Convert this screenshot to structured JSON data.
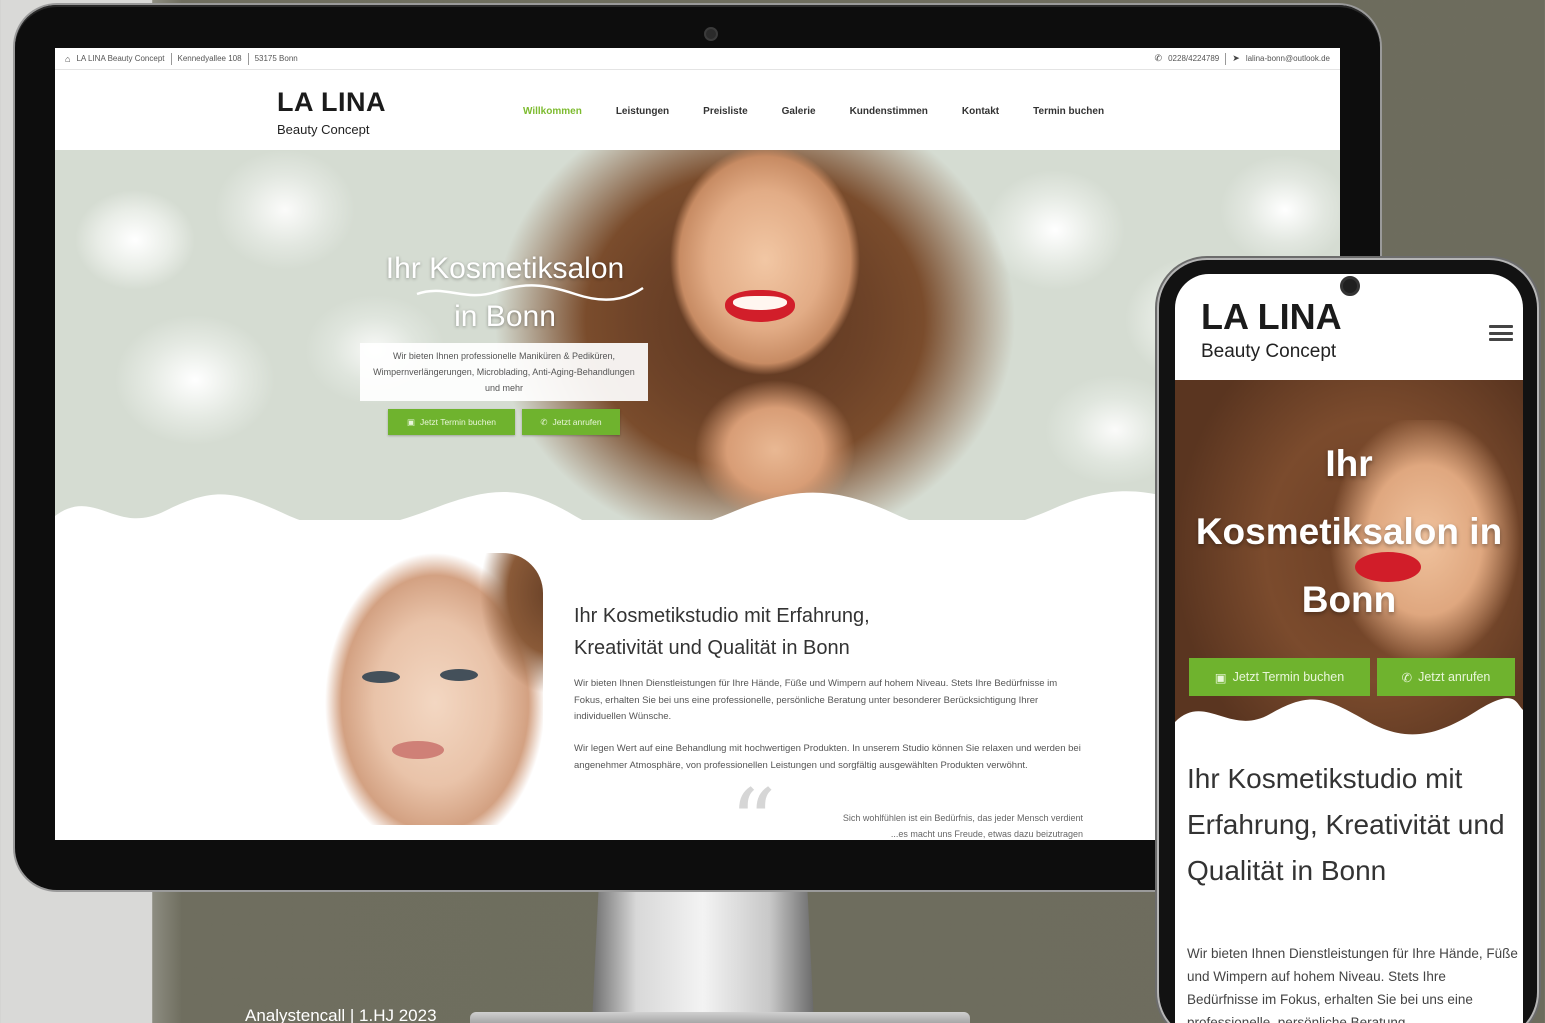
{
  "colors": {
    "accent_green": "#7dbb2f",
    "button_green": "#6fb32e",
    "backdrop": "#6f6e5f"
  },
  "desktop": {
    "topbar": {
      "left": [
        "LA LINA Beauty Concept",
        "Kennedyallee 108",
        "53175 Bonn"
      ],
      "phone": "0228/4224789",
      "email": "lalina-bonn@outlook.de"
    },
    "logo": {
      "main": "LA LINA",
      "sub": "Beauty Concept"
    },
    "nav": [
      "Willkommen",
      "Leistungen",
      "Preisliste",
      "Galerie",
      "Kundenstimmen",
      "Kontakt",
      "Termin buchen"
    ],
    "hero": {
      "title_line1": "Ihr Kosmetiksalon",
      "title_line2": "in Bonn",
      "description": "Wir bieten Ihnen professionelle Maniküren & Pediküren, Wimpernverlängerungen, Microblading, Anti-Aging-Behandlungen und mehr",
      "btn_book": "Jetzt Termin buchen",
      "btn_call": "Jetzt anrufen"
    },
    "side_icons": [
      "phone-icon",
      "mail-icon",
      "whatsapp-icon"
    ],
    "content": {
      "title_line1": "Ihr Kosmetikstudio mit Erfahrung,",
      "title_line2": "Kreativität und Qualität in Bonn",
      "p1": "Wir bieten Ihnen Dienstleistungen für Ihre Hände, Füße und Wimpern auf hohem Niveau. Stets Ihre Bedürfnisse im Fokus, erhalten Sie bei uns eine professionelle, persönliche Beratung unter besonderer Berücksichtigung Ihrer individuellen Wünsche.",
      "p2": "Wir legen Wert auf eine Behandlung mit hochwertigen Produkten. In unserem Studio können Sie relaxen und werden bei angenehmer Atmosphäre, von professionellen Leistungen und sorgfältig ausgewählten Produkten verwöhnt.",
      "quote_line1": "Sich wohlfühlen ist ein Bedürfnis, das jeder Mensch verdient",
      "quote_line2": "...es macht uns Freude, etwas dazu beizutragen"
    }
  },
  "mobile": {
    "logo": {
      "main": "LA LINA",
      "sub": "Beauty Concept"
    },
    "hero": {
      "title_line1": "Ihr",
      "title_line2": "Kosmetiksalon in",
      "title_line3": "Bonn",
      "btn_book": "Jetzt Termin buchen",
      "btn_call": "Jetzt anrufen"
    },
    "content": {
      "title": "Ihr Kosmetikstudio mit Erfahrung, Kreativität und Qualität in Bonn",
      "text": "Wir bieten Ihnen Dienstleistungen für Ihre Hände, Füße und Wimpern auf hohem Niveau. Stets Ihre Bedürfnisse im Fokus, erhalten Sie bei uns eine professionelle, persönliche Beratung"
    }
  },
  "caption": "Analystencall | 1.HJ 2023"
}
